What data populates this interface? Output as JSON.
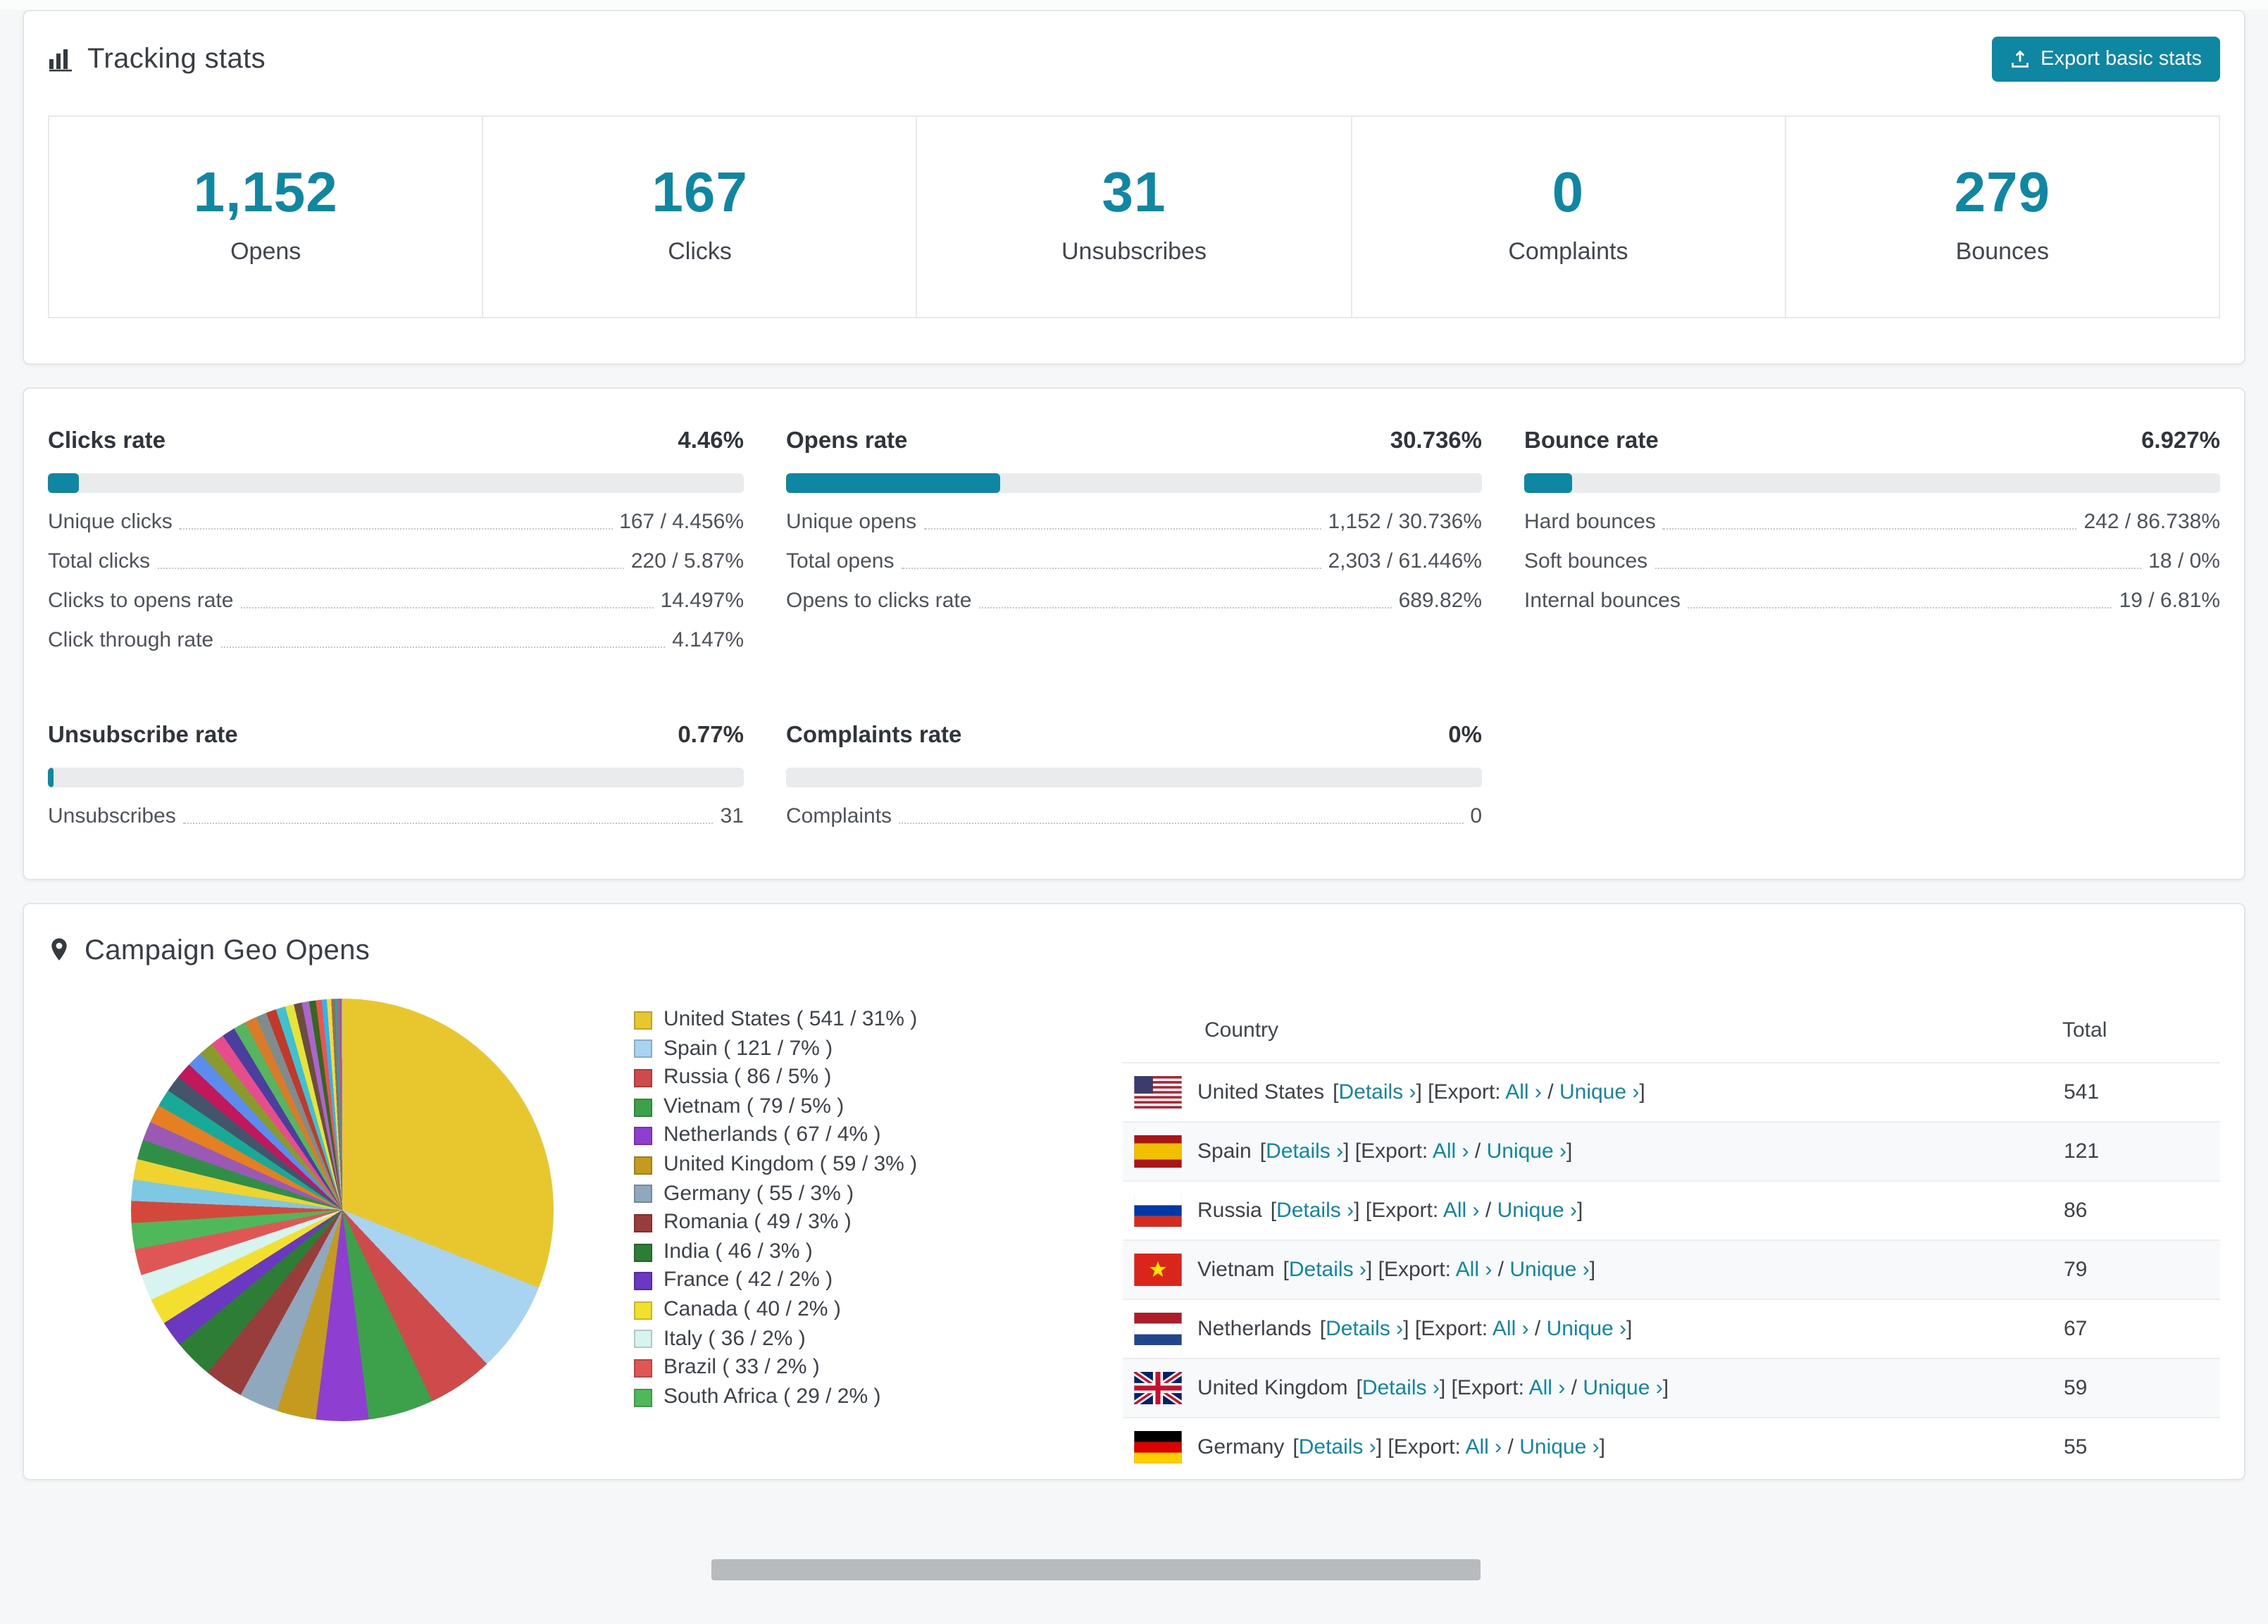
{
  "theme": {
    "accent": "#0f87a3"
  },
  "tracking": {
    "title": "Tracking stats",
    "export_label": "Export basic stats",
    "stats": [
      {
        "value": "1,152",
        "label": "Opens"
      },
      {
        "value": "167",
        "label": "Clicks"
      },
      {
        "value": "31",
        "label": "Unsubscribes"
      },
      {
        "value": "0",
        "label": "Complaints"
      },
      {
        "value": "279",
        "label": "Bounces"
      }
    ]
  },
  "rates": [
    {
      "title": "Clicks rate",
      "value": "4.46%",
      "percent": 4.46,
      "rows": [
        {
          "label": "Unique clicks",
          "value": "167 / 4.456%"
        },
        {
          "label": "Total clicks",
          "value": "220 / 5.87%"
        },
        {
          "label": "Clicks to opens rate",
          "value": "14.497%"
        },
        {
          "label": "Click through rate",
          "value": "4.147%"
        }
      ]
    },
    {
      "title": "Opens rate",
      "value": "30.736%",
      "percent": 30.736,
      "rows": [
        {
          "label": "Unique opens",
          "value": "1,152 / 30.736%"
        },
        {
          "label": "Total opens",
          "value": "2,303 / 61.446%"
        },
        {
          "label": "Opens to clicks rate",
          "value": "689.82%"
        }
      ]
    },
    {
      "title": "Bounce rate",
      "value": "6.927%",
      "percent": 6.927,
      "rows": [
        {
          "label": "Hard bounces",
          "value": "242 / 86.738%"
        },
        {
          "label": "Soft bounces",
          "value": "18 / 0%"
        },
        {
          "label": "Internal bounces",
          "value": "19 / 6.81%"
        }
      ]
    },
    {
      "title": "Unsubscribe rate",
      "value": "0.77%",
      "percent": 0.77,
      "rows": [
        {
          "label": "Unsubscribes",
          "value": "31"
        }
      ]
    },
    {
      "title": "Complaints rate",
      "value": "0%",
      "percent": 0,
      "rows": [
        {
          "label": "Complaints",
          "value": "0"
        }
      ]
    }
  ],
  "geo": {
    "title": "Campaign Geo Opens",
    "chart_data": {
      "type": "pie",
      "title": "Campaign Geo Opens",
      "legend_position": "right",
      "series": [
        {
          "label": "United States",
          "value": 541,
          "percent": 31,
          "color": "#e8c62e"
        },
        {
          "label": "Spain",
          "value": 121,
          "percent": 7,
          "color": "#a8d4f2"
        },
        {
          "label": "Russia",
          "value": 86,
          "percent": 5,
          "color": "#cf4a4a"
        },
        {
          "label": "Vietnam",
          "value": 79,
          "percent": 5,
          "color": "#3da04a"
        },
        {
          "label": "Netherlands",
          "value": 67,
          "percent": 4,
          "color": "#8e3fd1"
        },
        {
          "label": "United Kingdom",
          "value": 59,
          "percent": 3,
          "color": "#c49a1f"
        },
        {
          "label": "Germany",
          "value": 55,
          "percent": 3,
          "color": "#8fa8bd"
        },
        {
          "label": "Romania",
          "value": 49,
          "percent": 3,
          "color": "#993c3c"
        },
        {
          "label": "India",
          "value": 46,
          "percent": 3,
          "color": "#2e7d36"
        },
        {
          "label": "France",
          "value": 42,
          "percent": 2,
          "color": "#6b38c2"
        },
        {
          "label": "Canada",
          "value": 40,
          "percent": 2,
          "color": "#f2df2e"
        },
        {
          "label": "Italy",
          "value": 36,
          "percent": 2,
          "color": "#d8f4f0"
        },
        {
          "label": "Brazil",
          "value": 33,
          "percent": 2,
          "color": "#e05555"
        },
        {
          "label": "South Africa",
          "value": 29,
          "percent": 2,
          "color": "#4fb85a"
        }
      ],
      "others_percent": 26,
      "others_note": "many small unlabeled slices",
      "others_colors": [
        "#d4483b",
        "#7ec8e3",
        "#f0d32f",
        "#2f8f46",
        "#9b59b6",
        "#e67e22",
        "#18a999",
        "#44546a",
        "#c2185b",
        "#5b8def",
        "#8a9a2b",
        "#e74c8c",
        "#4a3f9f",
        "#57b55f",
        "#d97b29",
        "#7f8c8d",
        "#c0392b",
        "#3fc1d3",
        "#e8e337",
        "#6d4c41",
        "#aa66cc",
        "#33691e",
        "#ef5350",
        "#29b6f6",
        "#fdd835",
        "#8d6e63",
        "#26a69a",
        "#ec407a",
        "#5c6bc0",
        "#9ccc65"
      ]
    },
    "table": {
      "headers": [
        "Country",
        "Total"
      ],
      "details_label": "Details ›",
      "export_label": "Export:",
      "all_label": "All ›",
      "unique_label": "Unique ›",
      "brackets": {
        "open": "[",
        "close": "]",
        "separator": "/"
      },
      "rows": [
        {
          "country": "United States",
          "flag": "us",
          "total": "541"
        },
        {
          "country": "Spain",
          "flag": "es",
          "total": "121"
        },
        {
          "country": "Russia",
          "flag": "ru",
          "total": "86"
        },
        {
          "country": "Vietnam",
          "flag": "vn",
          "total": "79"
        },
        {
          "country": "Netherlands",
          "flag": "nl",
          "total": "67"
        },
        {
          "country": "United Kingdom",
          "flag": "gb",
          "total": "59"
        },
        {
          "country": "Germany",
          "flag": "de",
          "total": "55"
        }
      ]
    }
  }
}
